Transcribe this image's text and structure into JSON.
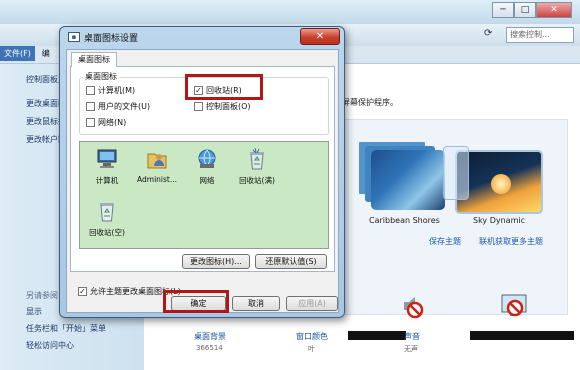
{
  "background": {
    "window_buttons": [
      "─",
      "□",
      "✕"
    ],
    "search_placeholder": "搜索控制...",
    "menu": [
      {
        "label": "文件(F)"
      },
      {
        "label": "编"
      }
    ],
    "left_links": [
      "控制面板主",
      "更改桌面图",
      "更改鼠标指",
      "更改帐户图"
    ],
    "see_also_title": "另请参阅",
    "bottom_links": [
      "显示",
      "任务栏和「开始」菜单",
      "轻松访问中心"
    ],
    "main_hint": "屏幕保护程序。",
    "themes": [
      {
        "name": "Caribbean Shores"
      },
      {
        "name": "Sky Dynamic"
      }
    ],
    "theme_links": {
      "save": "保存主题",
      "online": "联机获取更多主题"
    },
    "bottom_items": [
      {
        "label": "桌面背景",
        "sub": "366514"
      },
      {
        "label": "窗口颜色",
        "sub": "叶"
      },
      {
        "label": "声音",
        "sub": "无声"
      },
      {
        "label": "",
        "sub": ""
      }
    ]
  },
  "dialog": {
    "title": "桌面图标设置",
    "close_label": "✕",
    "tab_label": "桌面图标",
    "group_title": "桌面图标",
    "checkboxes": [
      {
        "label": "计算机(M)",
        "checked": false
      },
      {
        "label": "回收站(R)",
        "checked": true
      },
      {
        "label": "用户的文件(U)",
        "checked": false
      },
      {
        "label": "控制面板(O)",
        "checked": false
      },
      {
        "label": "网络(N)",
        "checked": false
      }
    ],
    "icons": [
      {
        "label": "计算机",
        "icon": "computer-icon"
      },
      {
        "label": "Administ...",
        "icon": "user-folder-icon"
      },
      {
        "label": "网络",
        "icon": "network-icon"
      },
      {
        "label": "回收站(满)",
        "icon": "recycle-bin-full-icon"
      },
      {
        "label": "回收站(空)",
        "icon": "recycle-bin-empty-icon"
      }
    ],
    "change_icon_label": "更改图标(H)...",
    "restore_default_label": "还原默认值(S)",
    "allow_themes_label": "允许主题更改桌面图标(L)",
    "allow_themes_checked": true,
    "ok_label": "确定",
    "cancel_label": "取消",
    "apply_label": "应用(A)",
    "highlight_color": "#b01818"
  }
}
